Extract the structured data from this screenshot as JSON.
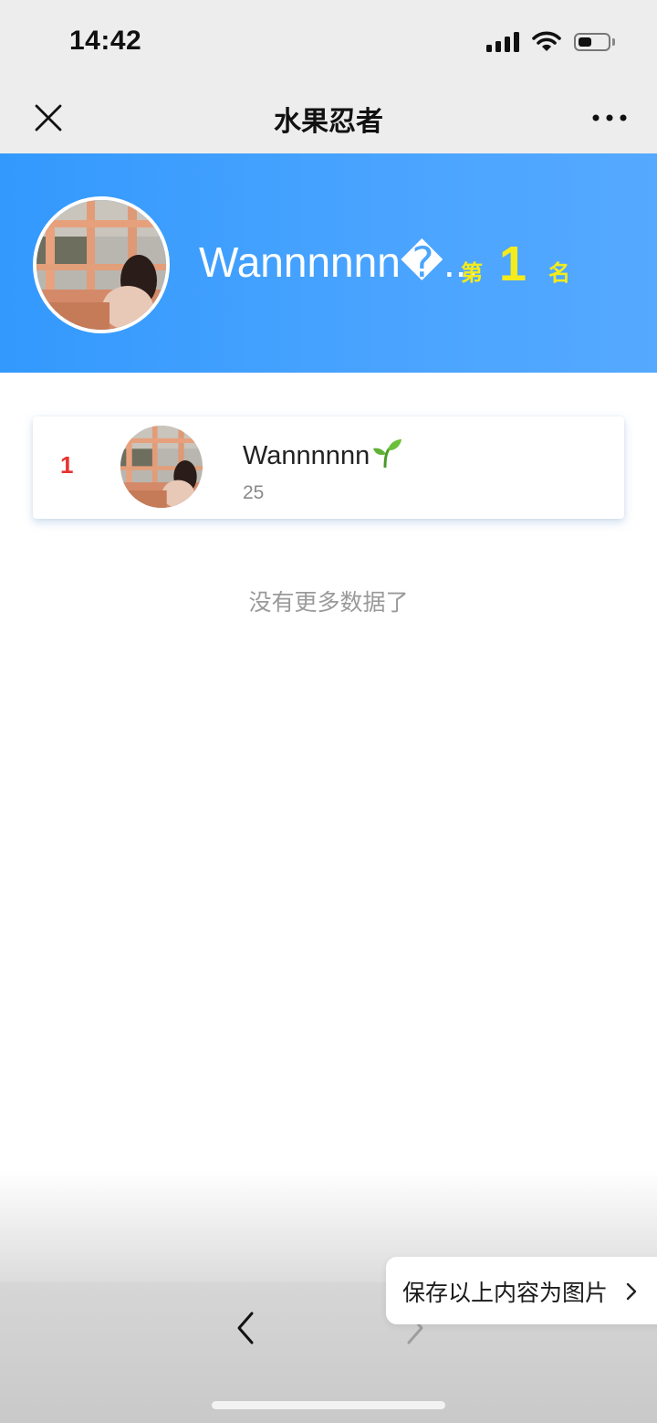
{
  "status_bar": {
    "time": "14:42",
    "icons": [
      "signal-icon",
      "wifi-icon",
      "battery-icon"
    ],
    "battery_level": 0.45
  },
  "nav": {
    "title": "水果忍者",
    "close_icon": "close-icon",
    "more_icon": "more-icon"
  },
  "hero": {
    "name": "Wannnnnn�...",
    "rank_prefix": "第",
    "rank": "1",
    "rank_suffix": "名",
    "background_color": "#3399fd",
    "accent_color": "#f4ec1a"
  },
  "leaderboard": {
    "rows": [
      {
        "rank": "1",
        "name": "Wannnnnn",
        "name_emoji": "seedling-icon",
        "score": "25",
        "rank_color": "#e8322f"
      }
    ],
    "end_text": "没有更多数据了"
  },
  "bottom": {
    "save_label": "保存以上内容为图片",
    "back_icon": "chevron-left-icon",
    "forward_icon": "chevron-right-icon"
  }
}
